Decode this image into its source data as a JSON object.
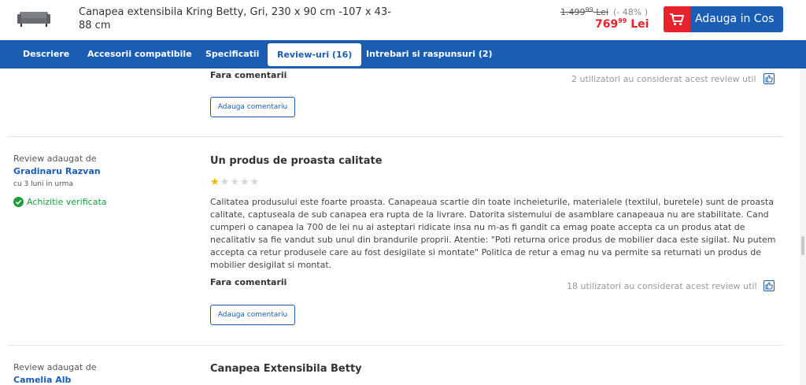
{
  "product": {
    "title": "Canapea extensibila Kring Betty, Gri, 230 x 90 cm -107 x 43-88 cm",
    "old_price_main": "1.499",
    "old_price_cents": "99",
    "old_price_currency": "Lei",
    "discount": "(- 48% )",
    "new_price_main": "769",
    "new_price_cents": "99",
    "new_price_currency": "Lei",
    "add_to_cart_label": "Adauga in Cos"
  },
  "tabs": [
    {
      "label": "Descriere"
    },
    {
      "label": "Accesorii compatibile"
    },
    {
      "label": "Specificatii"
    },
    {
      "label": "Review-uri (16)"
    },
    {
      "label": "Intrebari si raspunsuri (2)"
    }
  ],
  "active_tab": "Review-uri (16)",
  "reviews": [
    {
      "comments_label": "Fara comentarii",
      "helpful_text": "2 utilizatori au considerat acest review util",
      "add_comment_label": "Adauga comentariu"
    },
    {
      "meta_label": "Review adaugat de",
      "author": "Gradinaru Razvan",
      "time": "cu 3 luni in urma",
      "verified_label": "Achizitie verificata",
      "title": "Un produs de proasta calitate",
      "rating": 1,
      "rating_max": 5,
      "body": "Calitatea produsului este foarte proasta. Canapeaua scartie din toate incheieturile, materialele (textilul, buretele) sunt de proasta calitate, captuseala de sub canapea era rupta de la livrare. Datorita sistemului de asamblare canapeaua nu are stabilitate. Cand cumperi o canapea la 700 de lei nu ai asteptari ridicate insa nu m-as fi gandit ca emag poate accepta ca un produs atat de necalitativ sa fie vandut sub unul din brandurile proprii. Atentie: \"Poti returna orice produs de mobilier daca este sigilat. Nu putem accepta ca retur produsele care au fost desigilate si montate\" Politica de retur a emag nu va permite sa returnati un produs de mobilier desigilat si montat.",
      "comments_label": "Fara comentarii",
      "helpful_text": "18 utilizatori au considerat acest review util",
      "add_comment_label": "Adauga comentariu"
    },
    {
      "meta_label": "Review adaugat de",
      "author": "Camelia Alb",
      "title": "Canapea Extensibila Betty"
    }
  ],
  "colors": {
    "brand_blue": "#1a5eb4",
    "price_red": "#e8232b",
    "verified_green": "#1a9e3a",
    "star_filled": "#f5b301",
    "star_empty": "#d6d6d6"
  },
  "icons": {
    "product_thumbnail": "sofa-thumbnail",
    "cart": "cart-icon",
    "thumbs_up": "thumbs-up-icon",
    "verified": "check-circle-icon",
    "star": "star-icon"
  }
}
